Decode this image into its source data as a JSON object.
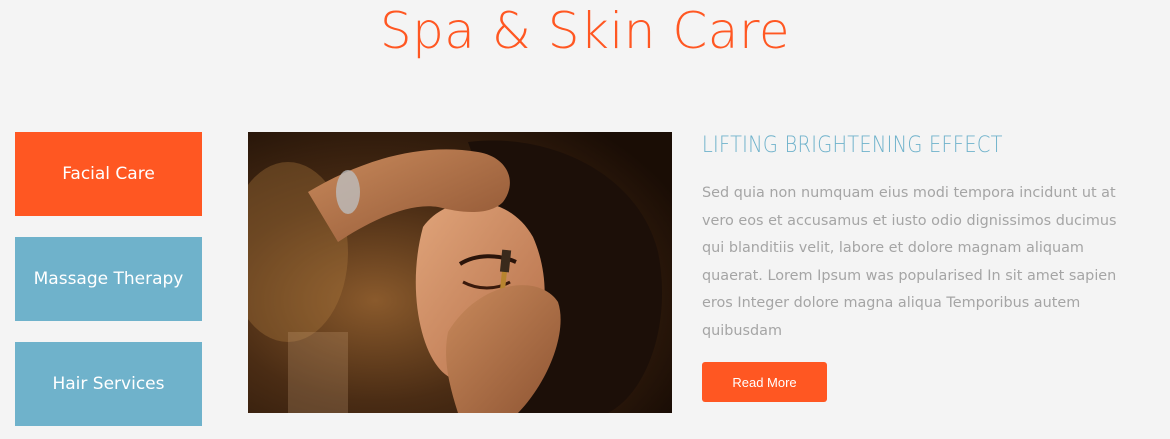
{
  "section": {
    "title": "Spa & Skin Care"
  },
  "tabs": [
    {
      "label": "Facial Care",
      "active": true
    },
    {
      "label": "Massage Therapy",
      "active": false
    },
    {
      "label": "Hair Services",
      "active": false
    }
  ],
  "content": {
    "heading": "LIFTING BRIGHTENING EFFECT",
    "body": "Sed quia non numquam eius modi tempora incidunt ut at vero eos et accusamus et iusto odio dignissimos ducimus qui blanditiis velit, labore et dolore magnam aliquam quaerat. Lorem Ipsum was popularised In sit amet sapien eros Integer dolore magna aliqua Temporibus autem quibusdam",
    "button_label": "Read More",
    "image_icon": "makeup-application-photo"
  },
  "colors": {
    "accent": "#ff5722",
    "secondary": "#6fb2cb",
    "background": "#f4f4f4",
    "body_text": "#a5a5a5"
  }
}
